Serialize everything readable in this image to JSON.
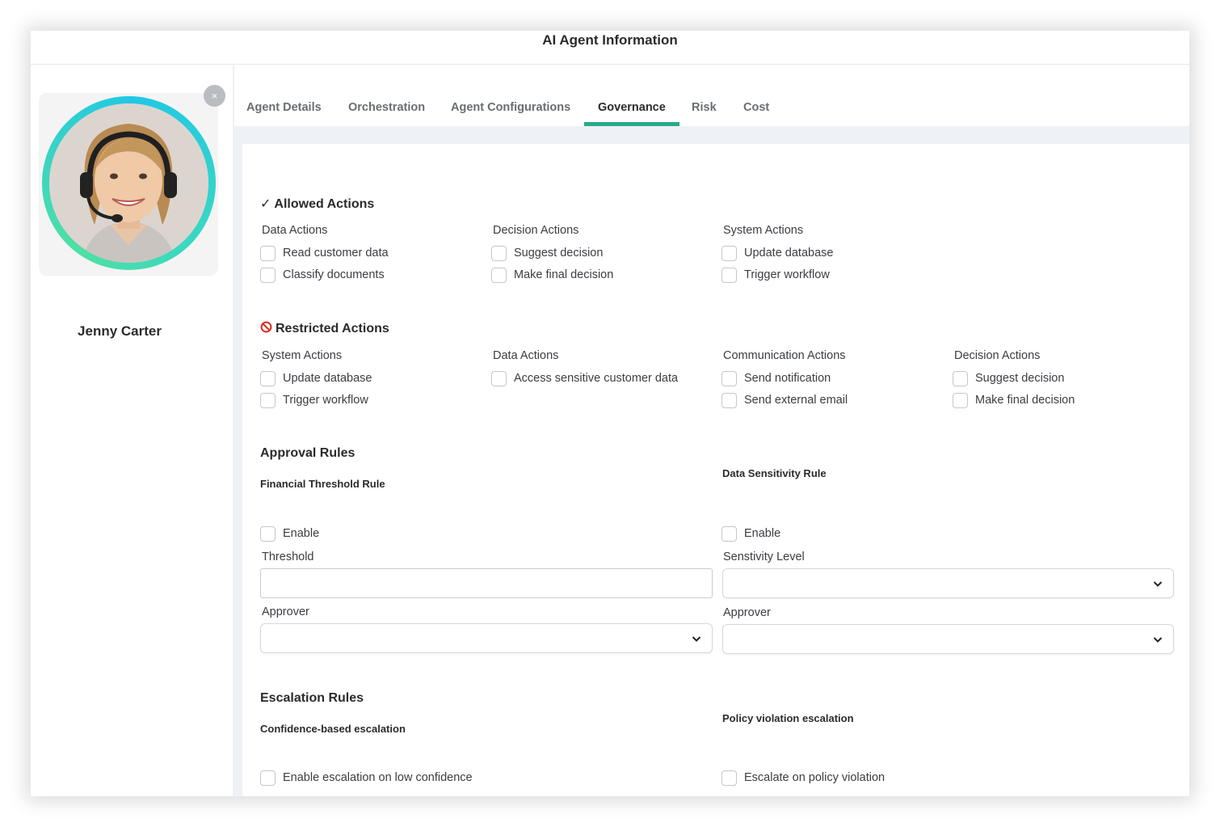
{
  "window": {
    "title": "AI Agent Information"
  },
  "agent": {
    "name": "Jenny Carter",
    "close_icon": "×"
  },
  "tabs": [
    {
      "label": "Agent Details"
    },
    {
      "label": "Orchestration"
    },
    {
      "label": "Agent Configurations"
    },
    {
      "label": "Governance"
    },
    {
      "label": "Risk"
    },
    {
      "label": "Cost"
    }
  ],
  "active_tab": "Governance",
  "allowed": {
    "mark": "✓",
    "title": "Allowed Actions",
    "groups": [
      {
        "heading": "Data Actions",
        "items": [
          "Read customer data",
          "Classify documents"
        ]
      },
      {
        "heading": "Decision Actions",
        "items": [
          "Suggest decision",
          "Make final decision"
        ]
      },
      {
        "heading": "System Actions",
        "items": [
          "Update database",
          "Trigger workflow"
        ]
      }
    ]
  },
  "restricted": {
    "title": "Restricted Actions",
    "groups": [
      {
        "heading": "System Actions",
        "items": [
          "Update database",
          "Trigger workflow"
        ]
      },
      {
        "heading": "Data Actions",
        "items": [
          "Access sensitive customer data"
        ]
      },
      {
        "heading": "Communication Actions",
        "items": [
          "Send notification",
          "Send external email"
        ]
      },
      {
        "heading": "Decision Actions",
        "items": [
          "Suggest decision",
          "Make final decision"
        ]
      }
    ]
  },
  "approval": {
    "title": "Approval Rules",
    "financial": {
      "heading": "Financial Threshold Rule",
      "enable_label": "Enable",
      "threshold_label": "Threshold",
      "threshold_value": "",
      "approver_label": "Approver",
      "approver_value": ""
    },
    "sensitivity": {
      "heading": "Data Sensitivity Rule",
      "enable_label": "Enable",
      "level_label": "Senstivity Level",
      "level_value": "",
      "approver_label": "Approver",
      "approver_value": ""
    }
  },
  "escalation": {
    "title": "Escalation Rules",
    "confidence": {
      "heading": "Confidence-based escalation",
      "label": "Enable escalation on low confidence"
    },
    "policy": {
      "heading": "Policy violation escalation",
      "label": "Escalate on policy violation"
    }
  },
  "colors": {
    "accent": "#29a98b",
    "ring_start": "#21c7e6",
    "ring_end": "#4fe0a3",
    "restricted": "#d93025"
  }
}
